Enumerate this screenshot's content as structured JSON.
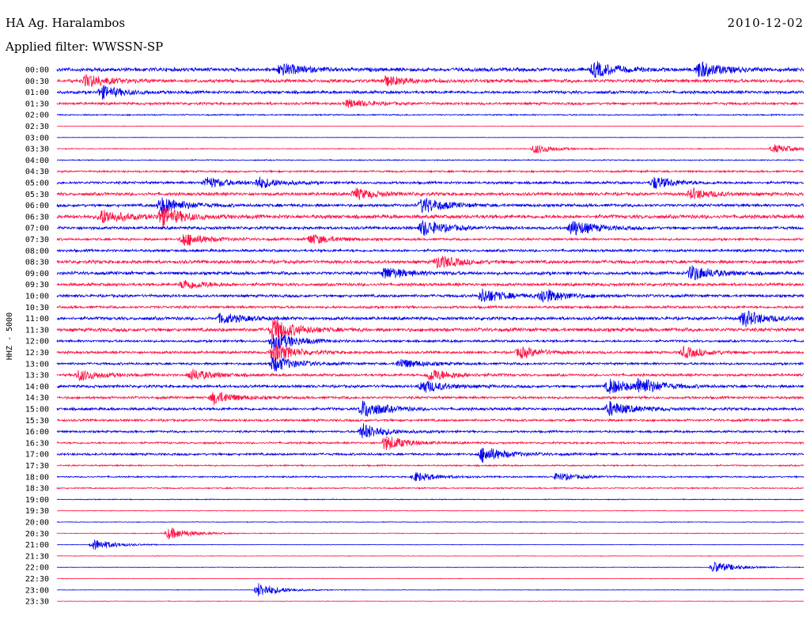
{
  "header": {
    "station": "HA Ag. Haralambos",
    "date": "2010-12-02",
    "filter": "Applied filter: WWSSN-SP"
  },
  "chart_data": {
    "type": "line",
    "title": "HA Ag. Haralambos",
    "ylabel": "HHZ - 5000",
    "row_labels": [
      "00:00",
      "00:30",
      "01:00",
      "01:30",
      "02:00",
      "02:30",
      "03:00",
      "03:30",
      "04:00",
      "04:30",
      "05:00",
      "05:30",
      "06:00",
      "06:30",
      "07:00",
      "07:30",
      "08:00",
      "08:30",
      "09:00",
      "09:30",
      "10:00",
      "10:30",
      "11:00",
      "11:30",
      "12:00",
      "12:30",
      "13:00",
      "13:30",
      "14:00",
      "14:30",
      "15:00",
      "15:30",
      "16:00",
      "16:30",
      "17:00",
      "17:30",
      "18:00",
      "18:30",
      "19:00",
      "19:30",
      "20:00",
      "20:30",
      "21:00",
      "21:30",
      "22:00",
      "22:30",
      "23:00",
      "23:30"
    ],
    "colors": [
      "#0000ee",
      "#ff1144"
    ],
    "noise_levels": [
      0.9,
      0.8,
      0.7,
      0.6,
      0.3,
      0.12,
      0.1,
      0.2,
      0.25,
      0.45,
      0.6,
      0.75,
      0.7,
      0.9,
      0.7,
      0.55,
      0.6,
      0.8,
      0.75,
      0.7,
      0.65,
      0.6,
      0.75,
      0.85,
      0.55,
      0.6,
      0.55,
      0.6,
      0.65,
      0.6,
      0.65,
      0.55,
      0.5,
      0.45,
      0.55,
      0.35,
      0.35,
      0.3,
      0.2,
      0.15,
      0.15,
      0.18,
      0.12,
      0.12,
      0.12,
      0.12,
      0.12,
      0.12
    ],
    "events": [
      {
        "row": 0,
        "pos": 0.3,
        "amp": 1.5
      },
      {
        "row": 0,
        "pos": 0.72,
        "amp": 1.9
      },
      {
        "row": 0,
        "pos": 0.86,
        "amp": 2.0
      },
      {
        "row": 1,
        "pos": 0.04,
        "amp": 1.6
      },
      {
        "row": 1,
        "pos": 0.44,
        "amp": 1.2
      },
      {
        "row": 2,
        "pos": 0.06,
        "amp": 1.6
      },
      {
        "row": 3,
        "pos": 0.39,
        "amp": 1.0
      },
      {
        "row": 7,
        "pos": 0.64,
        "amp": 1.2
      },
      {
        "row": 7,
        "pos": 0.96,
        "amp": 1.1
      },
      {
        "row": 10,
        "pos": 0.2,
        "amp": 1.4
      },
      {
        "row": 10,
        "pos": 0.27,
        "amp": 1.3
      },
      {
        "row": 10,
        "pos": 0.8,
        "amp": 1.5
      },
      {
        "row": 11,
        "pos": 0.4,
        "amp": 1.3
      },
      {
        "row": 11,
        "pos": 0.85,
        "amp": 1.3
      },
      {
        "row": 12,
        "pos": 0.14,
        "amp": 2.2
      },
      {
        "row": 12,
        "pos": 0.49,
        "amp": 2.0
      },
      {
        "row": 13,
        "pos": 0.06,
        "amp": 1.8
      },
      {
        "row": 13,
        "pos": 0.14,
        "amp": 2.4
      },
      {
        "row": 14,
        "pos": 0.49,
        "amp": 2.0
      },
      {
        "row": 14,
        "pos": 0.69,
        "amp": 2.0
      },
      {
        "row": 15,
        "pos": 0.17,
        "amp": 1.7
      },
      {
        "row": 15,
        "pos": 0.34,
        "amp": 1.3
      },
      {
        "row": 17,
        "pos": 0.51,
        "amp": 1.6
      },
      {
        "row": 18,
        "pos": 0.44,
        "amp": 1.5
      },
      {
        "row": 18,
        "pos": 0.85,
        "amp": 1.9
      },
      {
        "row": 19,
        "pos": 0.17,
        "amp": 1.2
      },
      {
        "row": 20,
        "pos": 0.57,
        "amp": 1.8
      },
      {
        "row": 20,
        "pos": 0.65,
        "amp": 1.8
      },
      {
        "row": 22,
        "pos": 0.22,
        "amp": 1.3
      },
      {
        "row": 22,
        "pos": 0.92,
        "amp": 2.0
      },
      {
        "row": 23,
        "pos": 0.29,
        "amp": 2.8
      },
      {
        "row": 24,
        "pos": 0.29,
        "amp": 2.6
      },
      {
        "row": 25,
        "pos": 0.29,
        "amp": 2.4
      },
      {
        "row": 25,
        "pos": 0.62,
        "amp": 1.4
      },
      {
        "row": 25,
        "pos": 0.84,
        "amp": 1.4
      },
      {
        "row": 26,
        "pos": 0.29,
        "amp": 2.0
      },
      {
        "row": 26,
        "pos": 0.46,
        "amp": 1.2
      },
      {
        "row": 27,
        "pos": 0.03,
        "amp": 1.4
      },
      {
        "row": 27,
        "pos": 0.18,
        "amp": 1.4
      },
      {
        "row": 27,
        "pos": 0.5,
        "amp": 1.6
      },
      {
        "row": 28,
        "pos": 0.49,
        "amp": 1.6
      },
      {
        "row": 28,
        "pos": 0.74,
        "amp": 1.9
      },
      {
        "row": 28,
        "pos": 0.78,
        "amp": 1.9
      },
      {
        "row": 29,
        "pos": 0.21,
        "amp": 1.6
      },
      {
        "row": 30,
        "pos": 0.41,
        "amp": 2.2
      },
      {
        "row": 30,
        "pos": 0.74,
        "amp": 1.8
      },
      {
        "row": 32,
        "pos": 0.41,
        "amp": 2.0
      },
      {
        "row": 33,
        "pos": 0.44,
        "amp": 1.9
      },
      {
        "row": 34,
        "pos": 0.57,
        "amp": 2.0
      },
      {
        "row": 36,
        "pos": 0.48,
        "amp": 1.2
      },
      {
        "row": 36,
        "pos": 0.67,
        "amp": 1.0
      },
      {
        "row": 41,
        "pos": 0.15,
        "amp": 1.5
      },
      {
        "row": 42,
        "pos": 0.05,
        "amp": 1.4
      },
      {
        "row": 44,
        "pos": 0.88,
        "amp": 1.5
      },
      {
        "row": 46,
        "pos": 0.27,
        "amp": 1.8
      }
    ]
  }
}
